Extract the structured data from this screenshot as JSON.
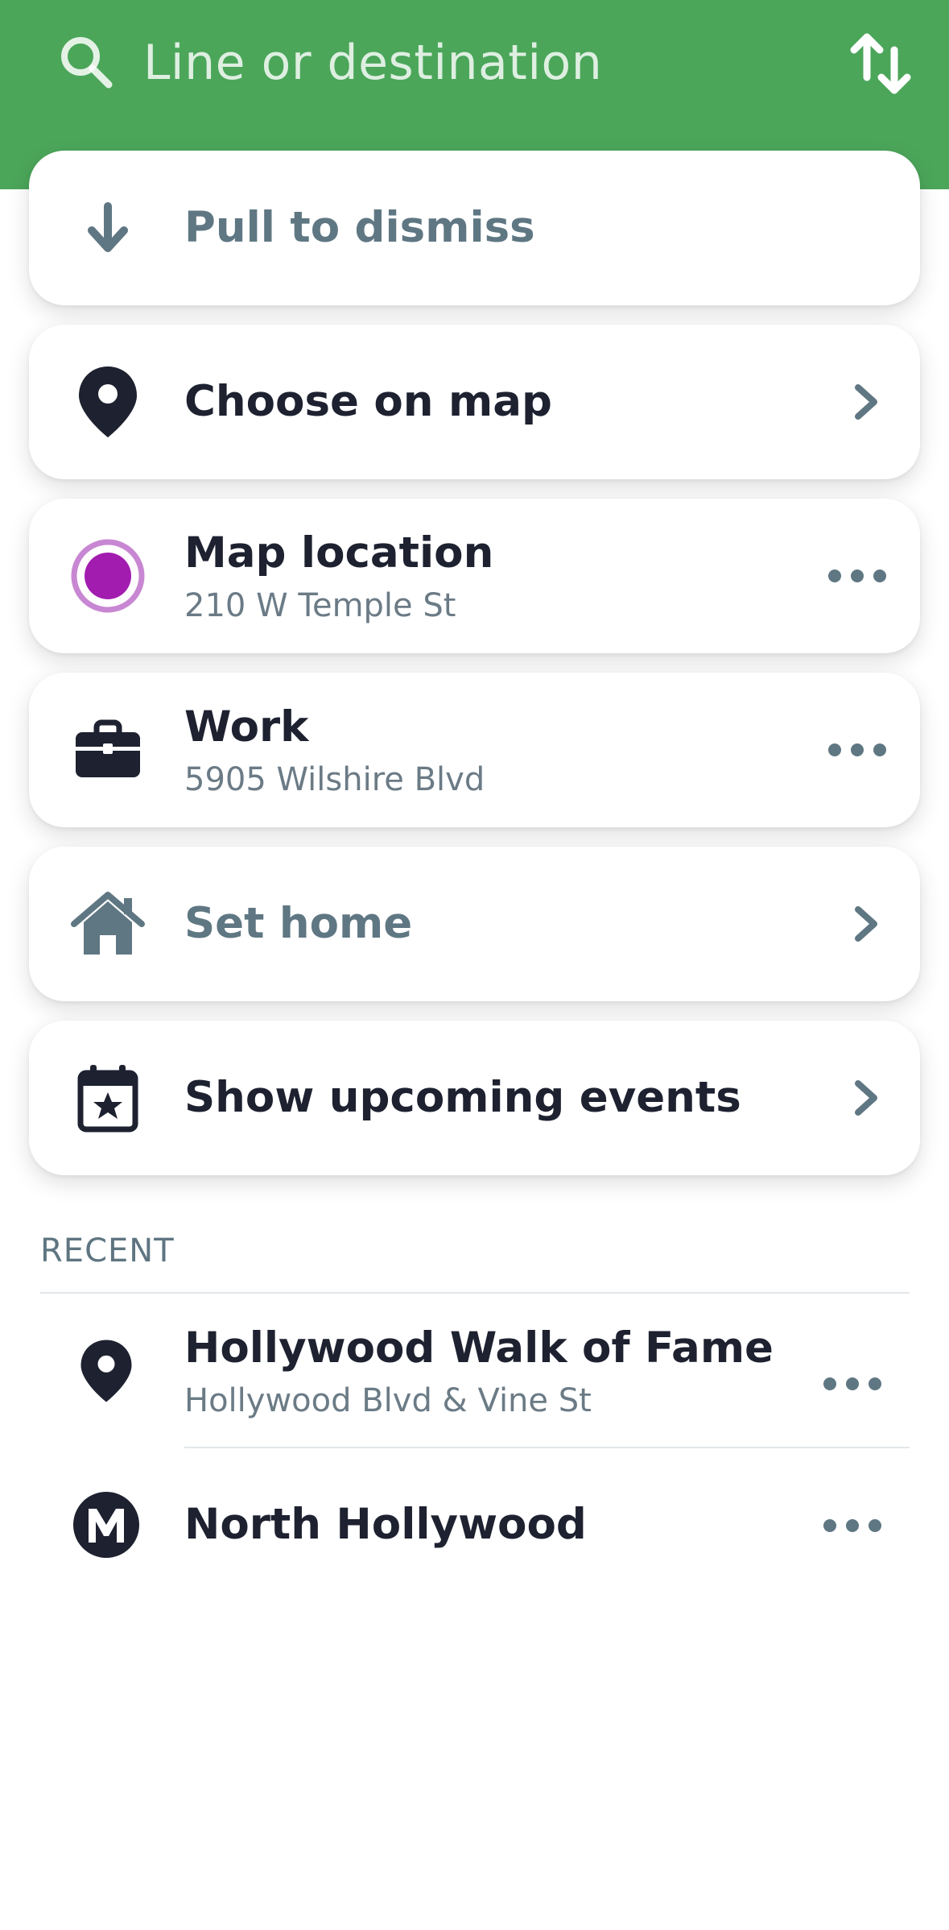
{
  "search": {
    "placeholder": "Line or destination"
  },
  "cards": {
    "pull": {
      "label": "Pull to dismiss"
    },
    "choose_map": {
      "label": "Choose on map"
    },
    "map_location": {
      "title": "Map location",
      "subtitle": "210 W Temple St"
    },
    "work": {
      "title": "Work",
      "subtitle": "5905 Wilshire Blvd"
    },
    "set_home": {
      "label": "Set home"
    },
    "events": {
      "label": "Show upcoming events"
    }
  },
  "recent": {
    "label": "RECENT",
    "items": [
      {
        "title": "Hollywood Walk of Fame",
        "subtitle": "Hollywood Blvd & Vine St",
        "icon": "location-pin-icon"
      },
      {
        "title": "North Hollywood",
        "icon": "metro-m-icon"
      }
    ]
  },
  "colors": {
    "header_green": "#4ba65a",
    "dark_icon": "#1d2130",
    "muted_slate": "#5f7783",
    "location_purple": "#a21cb0",
    "location_ring": "#c887d2"
  }
}
